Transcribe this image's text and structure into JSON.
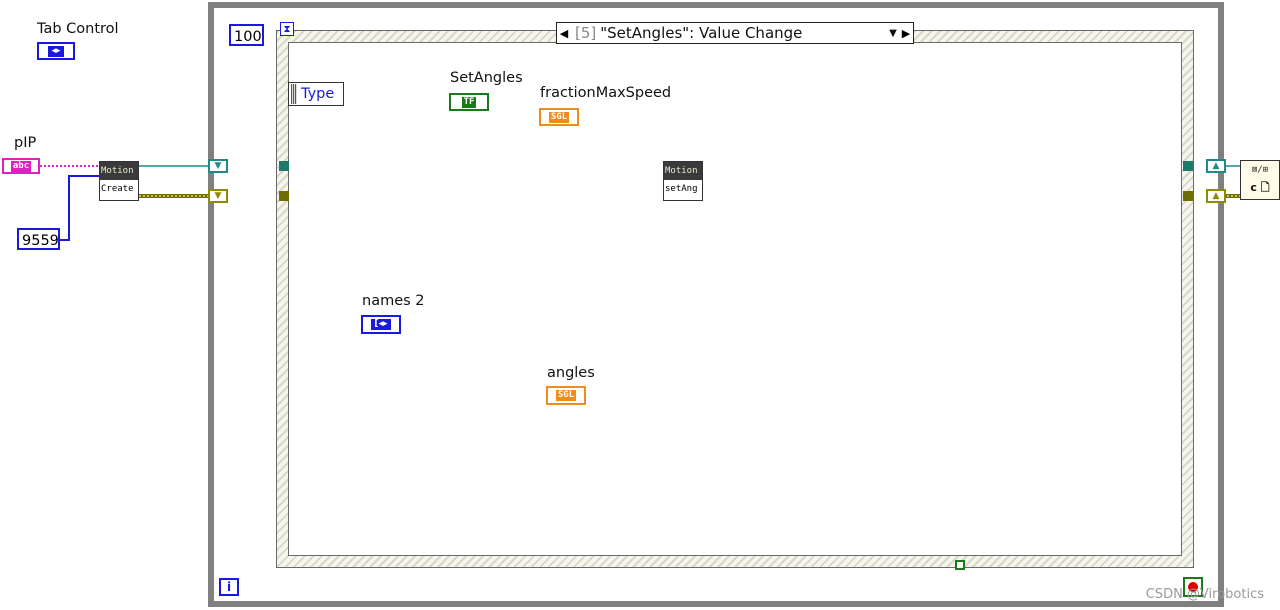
{
  "labels": {
    "tab_control": "Tab Control",
    "pip": "pIP",
    "set_angles": "SetAngles",
    "fraction_max_speed": "fractionMaxSpeed",
    "names2": "names 2",
    "angles": "angles",
    "type": "Type"
  },
  "constants": {
    "timeout": "100",
    "port": "9559"
  },
  "event_selector": {
    "index": "[5]",
    "label": "\"SetAngles\": Value Change"
  },
  "nodes": {
    "motion_create_header": "Motion",
    "motion_create_sub": "Create",
    "motion_setang_header": "Motion",
    "motion_setang_sub": "setAng"
  },
  "terminals": {
    "string_type": "abc",
    "bool_type": "TF",
    "sgl_type": "SGL",
    "array_glyph": "[◂▸",
    "enum_glyph": "◂▸",
    "info": "i"
  },
  "watermark": "CSDN @Virobotics",
  "colors": {
    "blue": "#1a1adf",
    "orange": "#f08c1e",
    "pink": "#e020c0",
    "teal": "#1e8a8a",
    "olive": "#8c8c00",
    "green": "#1a7a1a"
  }
}
